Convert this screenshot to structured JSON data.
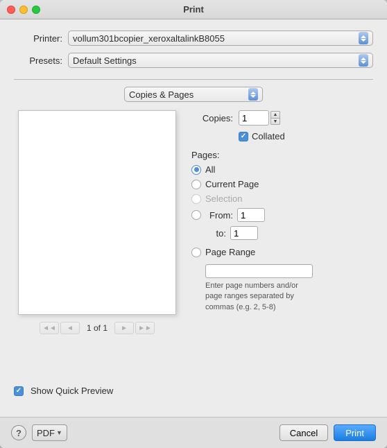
{
  "window": {
    "title": "Print"
  },
  "printer": {
    "label": "Printer:",
    "value": "vollum301bcopier_xeroxaltalinkB8055"
  },
  "presets": {
    "label": "Presets:",
    "value": "Default Settings"
  },
  "copies_pages": {
    "label": "Copies & Pages"
  },
  "copies": {
    "label": "Copies:",
    "value": "1"
  },
  "collated": {
    "label": "Collated",
    "checked": true
  },
  "pages": {
    "label": "Pages:",
    "options": [
      {
        "id": "all",
        "label": "All",
        "selected": true,
        "enabled": true
      },
      {
        "id": "current",
        "label": "Current Page",
        "selected": false,
        "enabled": true
      },
      {
        "id": "selection",
        "label": "Selection",
        "selected": false,
        "enabled": false
      }
    ]
  },
  "from": {
    "label": "From:",
    "value": "1"
  },
  "to": {
    "label": "to:",
    "value": "1"
  },
  "page_range": {
    "label": "Page Range",
    "hint": "Enter page numbers and/or page ranges separated by commas (e.g. 2, 5-8)"
  },
  "preview": {
    "page_label": "1 of 1"
  },
  "show_preview": {
    "label": "Show Quick Preview",
    "checked": true
  },
  "buttons": {
    "help": "?",
    "pdf": "PDF",
    "cancel": "Cancel",
    "print": "Print"
  }
}
